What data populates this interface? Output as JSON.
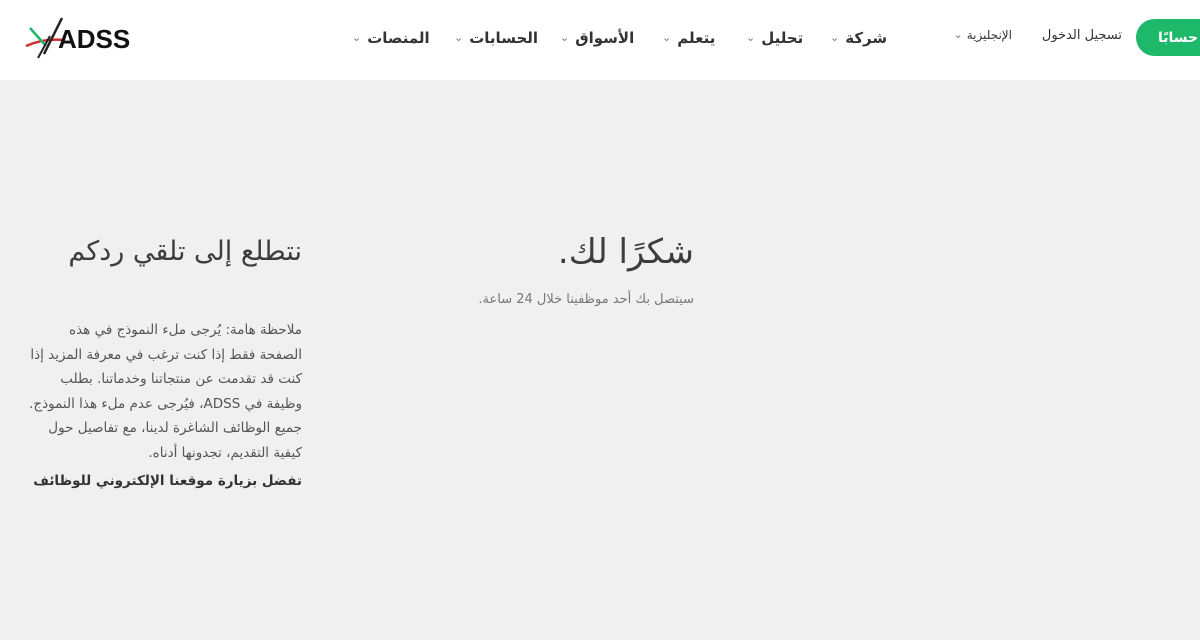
{
  "header": {
    "logo_text": "ADSS",
    "nav": [
      {
        "label": "المنصات"
      },
      {
        "label": "الحسابات"
      },
      {
        "label": "الأسواق"
      },
      {
        "label": "يتعلم"
      },
      {
        "label": "تحليل"
      },
      {
        "label": "شركة"
      }
    ],
    "language": "الإنجليزية",
    "login": "تسجيل الدخول",
    "cta": "افتح حسابًا",
    "chevron_icon": "chevron-down-icon"
  },
  "left": {
    "heading": "نتطلع إلى تلقي ردكم",
    "note": "ملاحظة هامة: يُرجى ملء النموذج في هذه الصفحة فقط إذا كنت ترغب في معرفة المزيد إذا كنت قد تقدمت عن منتجاتنا وخدماتنا. بطلب وظيفة في ADSS، فيُرجى عدم ملء هذا النموذج. جميع الوظائف الشاغرة لدينا، مع تفاصيل حول كيفية التقديم، تجدونها أدناه.",
    "link": "تفضل بزيارة موقعنا الإلكتروني للوظائف"
  },
  "thanks": {
    "heading": "شكرًا لك.",
    "subtitle": "سيتصل بك أحد موظفينا خلال 24 ساعة."
  },
  "colors": {
    "accent": "#1db86a",
    "background": "#f0f0f0",
    "header": "#ffffff"
  }
}
